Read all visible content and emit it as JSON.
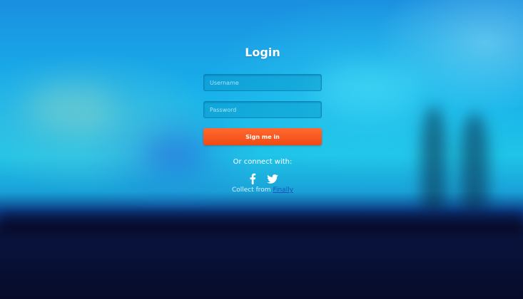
{
  "form": {
    "title": "Login",
    "username_placeholder": "Username",
    "password_placeholder": "Password",
    "signin_label": "Sign me in",
    "connect_text": "Or connect with:",
    "social_icons": [
      "facebook-icon",
      "twitter-icon"
    ],
    "credit_prefix": "Collect from",
    "credit_link": "Finally"
  },
  "colors": {
    "button": "#f04a14",
    "link": "#1d4fb8",
    "sky": "#18b0ea",
    "ground": "#080a2a"
  }
}
